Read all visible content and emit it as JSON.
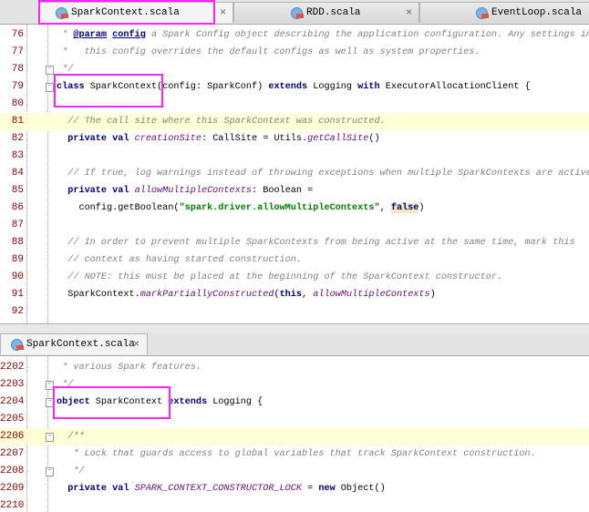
{
  "top_tabs": [
    {
      "label": "SparkContext.scala",
      "active": true
    },
    {
      "label": "RDD.scala"
    },
    {
      "label": "EventLoop.scala"
    }
  ],
  "bottom_tabs": [
    {
      "label": "SparkContext.scala",
      "active": true
    }
  ],
  "top_lines": [
    {
      "n": "76",
      "t": [
        [
          "c",
          " * "
        ],
        [
          "tag",
          "@param"
        ],
        [
          "c",
          " "
        ],
        [
          "tag",
          "config"
        ],
        [
          "c",
          " a Spark Config object describing the application configuration. Any settings in"
        ]
      ]
    },
    {
      "n": "77",
      "t": [
        [
          "c",
          " *   this config overrides the default configs as well as system properties."
        ]
      ]
    },
    {
      "n": "78",
      "t": [
        [
          "c",
          " */"
        ]
      ],
      "fold": true
    },
    {
      "n": "79",
      "t": [
        [
          "k",
          "class"
        ],
        [
          "p",
          " SparkContext(config: SparkConf) "
        ],
        [
          "k",
          "extends"
        ],
        [
          "p",
          " Logging "
        ],
        [
          "k",
          "with"
        ],
        [
          "p",
          " ExecutorAllocationClient {"
        ]
      ],
      "fold": true
    },
    {
      "n": "80",
      "t": []
    },
    {
      "n": "81",
      "t": [
        [
          "c",
          "  // The call site where this SparkContext was constructed."
        ]
      ],
      "cur": true
    },
    {
      "n": "82",
      "t": [
        [
          "k",
          "  private val "
        ],
        [
          "f",
          "creationSite"
        ],
        [
          "p",
          ": CallSite = Utils."
        ],
        [
          "f",
          "getCallSite"
        ],
        [
          "p",
          "()"
        ]
      ]
    },
    {
      "n": "83",
      "t": []
    },
    {
      "n": "84",
      "t": [
        [
          "c",
          "  // If true, log warnings instead of throwing exceptions when multiple SparkContexts are active"
        ]
      ]
    },
    {
      "n": "85",
      "t": [
        [
          "k",
          "  private val "
        ],
        [
          "f",
          "allowMultipleContexts"
        ],
        [
          "p",
          ": Boolean ="
        ]
      ]
    },
    {
      "n": "86",
      "t": [
        [
          "p",
          "    config.getBoolean("
        ],
        [
          "s",
          "\"spark.driver.allowMultipleContexts\""
        ],
        [
          "p",
          ", "
        ],
        [
          "kb",
          "false"
        ],
        [
          "p",
          ")"
        ]
      ]
    },
    {
      "n": "87",
      "t": []
    },
    {
      "n": "88",
      "t": [
        [
          "c",
          "  // In order to prevent multiple SparkContexts from being active at the same time, mark this"
        ]
      ]
    },
    {
      "n": "89",
      "t": [
        [
          "c",
          "  // context as having started construction."
        ]
      ]
    },
    {
      "n": "90",
      "t": [
        [
          "c",
          "  // NOTE: this must be placed at the beginning of the SparkContext constructor."
        ]
      ]
    },
    {
      "n": "91",
      "t": [
        [
          "p",
          "  SparkContext."
        ],
        [
          "f",
          "markPartiallyConstructed"
        ],
        [
          "p",
          "("
        ],
        [
          "k",
          "this"
        ],
        [
          "p",
          ", "
        ],
        [
          "f",
          "allowMultipleContexts"
        ],
        [
          "p",
          ")"
        ]
      ]
    },
    {
      "n": "92",
      "t": []
    }
  ],
  "bottom_lines": [
    {
      "n": "2202",
      "t": [
        [
          "c",
          " * various Spark features."
        ]
      ]
    },
    {
      "n": "2203",
      "t": [
        [
          "c",
          " */"
        ]
      ],
      "fold": true
    },
    {
      "n": "2204",
      "t": [
        [
          "k",
          "object"
        ],
        [
          "p",
          " SparkContext "
        ],
        [
          "k",
          "extends"
        ],
        [
          "p",
          " Logging {"
        ]
      ],
      "fold": true
    },
    {
      "n": "2205",
      "t": []
    },
    {
      "n": "2206",
      "t": [
        [
          "c",
          "  /**"
        ]
      ],
      "cur": true,
      "fold": true
    },
    {
      "n": "2207",
      "t": [
        [
          "c",
          "   * Lock that guards access to global variables that track SparkContext construction."
        ]
      ]
    },
    {
      "n": "2208",
      "t": [
        [
          "c",
          "   */"
        ]
      ],
      "fold": true
    },
    {
      "n": "2209",
      "t": [
        [
          "k",
          "  private val "
        ],
        [
          "f",
          "SPARK_CONTEXT_CONSTRUCTOR_LOCK"
        ],
        [
          "p",
          " = "
        ],
        [
          "k",
          "new"
        ],
        [
          "p",
          " Object()"
        ]
      ]
    },
    {
      "n": "2210",
      "t": []
    }
  ]
}
